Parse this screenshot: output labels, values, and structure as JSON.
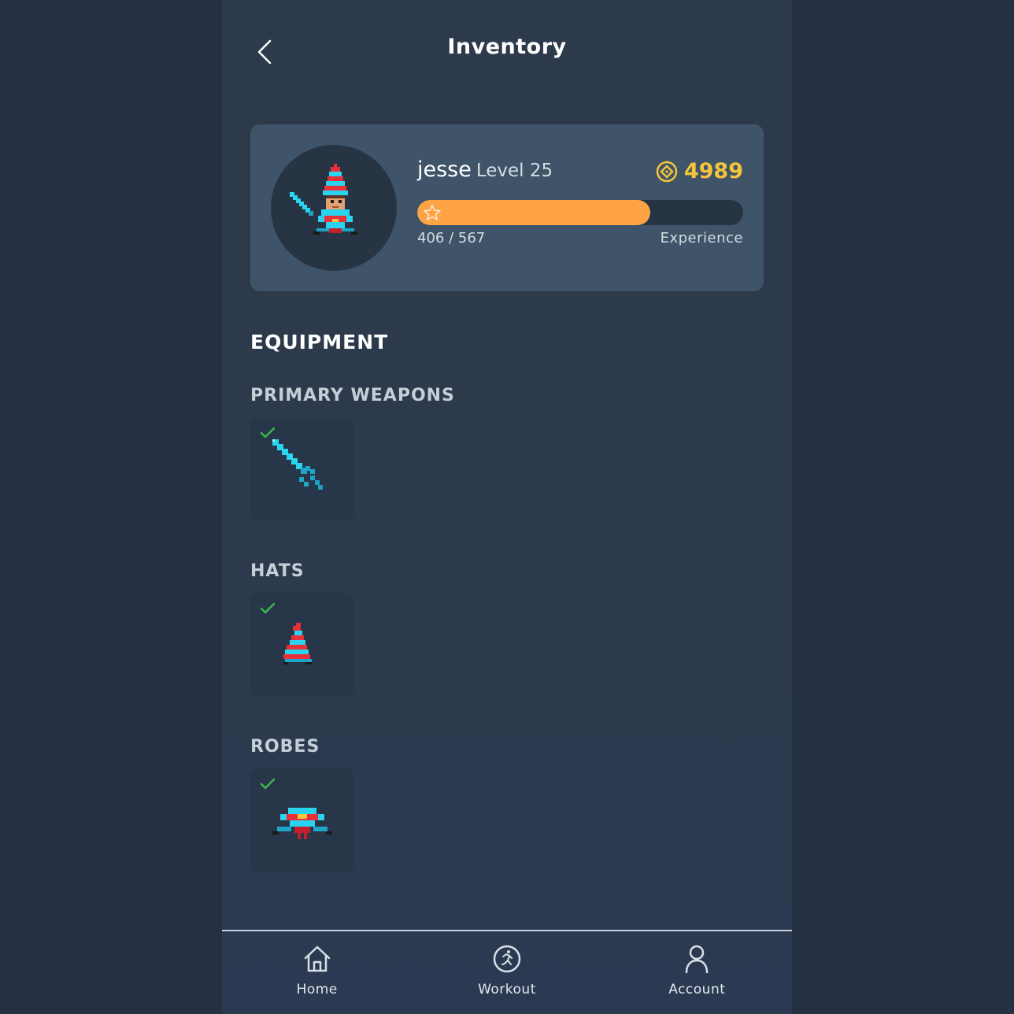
{
  "header": {
    "title": "Inventory",
    "back_icon": "chevron-left-icon"
  },
  "profile": {
    "name": "jesse",
    "level": "Level 25",
    "coins": "4989",
    "xp_current": 406,
    "xp_max": 567,
    "xp_text": "406 / 567",
    "xp_label": "Experience",
    "xp_fraction": 0.716
  },
  "equipment": {
    "title": "EQUIPMENT",
    "categories": [
      {
        "title": "PRIMARY WEAPONS",
        "item_icon": "sword-icon",
        "equipped": true
      },
      {
        "title": "HATS",
        "item_icon": "wizard-hat-icon",
        "equipped": true
      },
      {
        "title": "ROBES",
        "item_icon": "robe-icon",
        "equipped": true
      }
    ]
  },
  "tabbar": {
    "items": [
      {
        "label": "Home",
        "icon": "home-icon"
      },
      {
        "label": "Workout",
        "icon": "running-icon"
      },
      {
        "label": "Account",
        "icon": "user-icon"
      }
    ]
  },
  "colors": {
    "background": "#253142",
    "card": "#3f5468",
    "accent_orange": "#ffa347",
    "coin_yellow": "#f4c53b",
    "check_green": "#3bb54a"
  }
}
